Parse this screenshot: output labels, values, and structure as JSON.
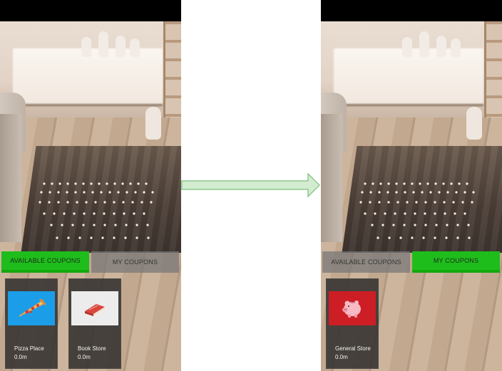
{
  "screens": [
    {
      "tabs": [
        {
          "label": "AVAILABLE COUPONS",
          "active": true
        },
        {
          "label": "MY COUPONS",
          "active": false
        }
      ],
      "coupons": [
        {
          "name": "Pizza Place",
          "distance": "0.0m",
          "icon": "pizza-icon",
          "thumb_color": "#1c9de8"
        },
        {
          "name": "Book Store",
          "distance": "0.0m",
          "icon": "book-icon",
          "thumb_color": "#ececec"
        }
      ]
    },
    {
      "tabs": [
        {
          "label": "AVAILABLE COUPONS",
          "active": false
        },
        {
          "label": "MY COUPONS",
          "active": true
        }
      ],
      "coupons": [
        {
          "name": "General Store",
          "distance": "0.0m",
          "icon": "piggy-bank-icon",
          "thumb_color": "#cc1e24"
        }
      ]
    }
  ],
  "colors": {
    "active_tab": "#1fbd1c",
    "inactive_tab": "#787878",
    "arrow_fill": "#d3ecd0",
    "arrow_stroke": "#7cbf7a"
  },
  "transition_icon": "right-arrow-icon"
}
